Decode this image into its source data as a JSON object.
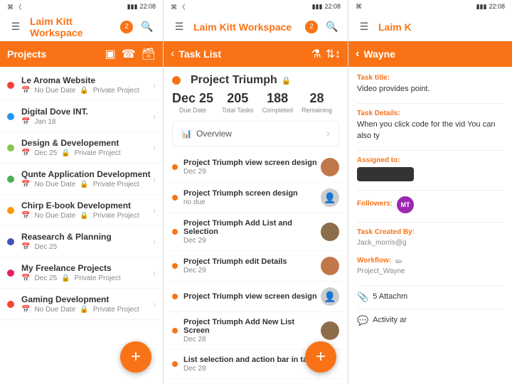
{
  "app": {
    "title": "Laim Kitt Workspace",
    "title_truncated": "Laim K",
    "badge": "2",
    "time": "22:08"
  },
  "panel1": {
    "tab_title": "Projects",
    "projects": [
      {
        "name": "Le Aroma Website",
        "color": "#f44336",
        "date": "No Due Date",
        "private": "Private Project"
      },
      {
        "name": "Digital Dove INT.",
        "color": "#2196f3",
        "date": "Jan 18",
        "private": ""
      },
      {
        "name": "Design & Developement",
        "color": "#8bc34a",
        "date": "Dec 25",
        "private": "Private Project"
      },
      {
        "name": "Qunte Application Development",
        "color": "#4caf50",
        "date": "No Due Date",
        "private": "Private Project"
      },
      {
        "name": "Chirp E-book Development",
        "color": "#ff9800",
        "date": "No Due Date",
        "private": "Private Project"
      },
      {
        "name": "Reasearch & Planning",
        "color": "#3f51b5",
        "date": "Dec 25",
        "private": ""
      },
      {
        "name": "My Freelance Projects",
        "color": "#e91e63",
        "date": "Dec 25",
        "private": "Private Project"
      },
      {
        "name": "Gaming Development",
        "color": "#f44336",
        "date": "No Due Date",
        "private": "Private Project"
      }
    ],
    "fab_label": "+"
  },
  "panel2": {
    "back_label": "Task List",
    "project_name": "Project Triumph",
    "due_date_label": "Dec 25",
    "due_date_sub": "Due Date",
    "total_tasks": "205",
    "total_tasks_label": "Total Tasks",
    "completed": "188",
    "completed_label": "Completed",
    "remaining": "28",
    "remaining_label": "Remaining",
    "overview_label": "Overview",
    "tasks": [
      {
        "name": "Project Triumph view screen design",
        "date": "Dec 29",
        "avatar_type": "photo"
      },
      {
        "name": "Project Triumph screen design",
        "date": "no due",
        "avatar_type": "gray"
      },
      {
        "name": "Project Triumph Add List and Selection",
        "date": "Dec 29",
        "avatar_type": "photo"
      },
      {
        "name": "Project Triumph edit Details",
        "date": "Dec 29",
        "avatar_type": "photo"
      },
      {
        "name": "Project Triumph view screen design",
        "date": "",
        "avatar_type": "gray"
      },
      {
        "name": "Project Triumph Add New List Screen",
        "date": "Dec 28",
        "avatar_type": "photo"
      },
      {
        "name": "List selection and action bar in task list",
        "date": "Dec 28",
        "avatar_type": "fab"
      }
    ],
    "fab_label": "+"
  },
  "panel3": {
    "back_label": "Wayne",
    "task_title_label": "Task title:",
    "task_title_text": "Video provides point.",
    "task_details_label": "Task Details:",
    "task_details_text": "When you click code for the vid You can also ty",
    "assigned_label": "Assigned to:",
    "followers_label": "Followers:",
    "followers_avatar": "MT",
    "created_label": "Task Created By:",
    "created_value": "Jack_morris@g",
    "workflow_label": "Workflow:",
    "workflow_value": "Project_Wayne",
    "attachments": "5 Attachm",
    "activity_label": "Activity ar"
  },
  "icons": {
    "menu": "☰",
    "search": "⌕",
    "grid": "⊞",
    "phone": "📞",
    "archive": "🗂",
    "filter": "⚗",
    "sort": "⇅",
    "back": "‹",
    "lock": "🔒",
    "overview_icon": "📊",
    "chevron": "›",
    "plus": "+",
    "paperclip": "📎",
    "chat": "💬",
    "pencil": "✏"
  }
}
